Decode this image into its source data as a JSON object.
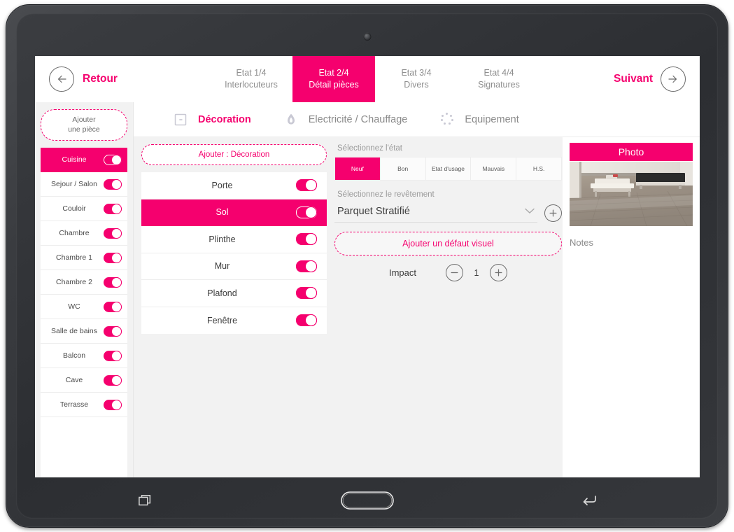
{
  "header": {
    "back_label": "Retour",
    "back_icon": "arrow-left-circle-icon",
    "next_label": "Suivant",
    "next_icon": "arrow-right-circle-icon",
    "steps": [
      {
        "line1": "Etat 1/4",
        "line2": "Interlocuteurs",
        "active": false
      },
      {
        "line1": "Etat 2/4",
        "line2": "Détail pièces",
        "active": true
      },
      {
        "line1": "Etat 3/4",
        "line2": "Divers",
        "active": false
      },
      {
        "line1": "Etat 4/4",
        "line2": "Signatures",
        "active": false
      }
    ]
  },
  "sidebar": {
    "add_room_line1": "Ajouter",
    "add_room_line2": "une pièce",
    "rooms": [
      {
        "label": "Cuisine",
        "selected": true,
        "toggle": true
      },
      {
        "label": "Sejour / Salon",
        "selected": false,
        "toggle": true
      },
      {
        "label": "Couloir",
        "selected": false,
        "toggle": true
      },
      {
        "label": "Chambre",
        "selected": false,
        "toggle": true
      },
      {
        "label": "Chambre 1",
        "selected": false,
        "toggle": true
      },
      {
        "label": "Chambre 2",
        "selected": false,
        "toggle": true
      },
      {
        "label": "WC",
        "selected": false,
        "toggle": true
      },
      {
        "label": "Salle de bains",
        "selected": false,
        "toggle": true
      },
      {
        "label": "Balcon",
        "selected": false,
        "toggle": true
      },
      {
        "label": "Cave",
        "selected": false,
        "toggle": true
      },
      {
        "label": "Terrasse",
        "selected": false,
        "toggle": true
      }
    ]
  },
  "category_tabs": [
    {
      "label": "Décoration",
      "icon": "paint-square-icon",
      "active": true
    },
    {
      "label": "Electricité / Chauffage",
      "icon": "flame-icon",
      "active": false
    },
    {
      "label": "Equipement",
      "icon": "dots-circle-icon",
      "active": false
    }
  ],
  "elements_panel": {
    "add_label": "Ajouter : Décoration",
    "items": [
      {
        "label": "Porte",
        "selected": false,
        "toggle": true
      },
      {
        "label": "Sol",
        "selected": true,
        "toggle": true
      },
      {
        "label": "Plinthe",
        "selected": false,
        "toggle": true
      },
      {
        "label": "Mur",
        "selected": false,
        "toggle": true
      },
      {
        "label": "Plafond",
        "selected": false,
        "toggle": true
      },
      {
        "label": "Fenêtre",
        "selected": false,
        "toggle": true
      }
    ]
  },
  "detail_panel": {
    "state_label": "Sélectionnez l'état",
    "state_options": [
      {
        "label": "Neuf",
        "active": true
      },
      {
        "label": "Bon",
        "active": false
      },
      {
        "label": "Etat d'usage",
        "active": false
      },
      {
        "label": "Mauvais",
        "active": false
      },
      {
        "label": "H.S.",
        "active": false
      }
    ],
    "covering_label": "Sélectionnez le revêtement",
    "covering_value": "Parquet Stratifié",
    "covering_dropdown_icon": "chevron-down-icon",
    "covering_add_icon": "plus-circle-icon",
    "add_defect_label": "Ajouter un défaut visuel",
    "impact_label": "Impact",
    "impact_value": "1",
    "impact_minus_icon": "minus-circle-icon",
    "impact_plus_icon": "plus-circle-icon"
  },
  "photo_panel": {
    "header_label": "Photo",
    "photo_alt": "room-floor-photo",
    "notes_label": "Notes"
  },
  "android_nav": [
    {
      "name": "recents-button",
      "icon": "recents-icon"
    },
    {
      "name": "home-button",
      "icon": "home-icon"
    },
    {
      "name": "back-button",
      "icon": "back-arrow-icon"
    }
  ],
  "colors": {
    "accent": "#f5006e",
    "muted_text": "#8e8e8e",
    "panel_bg": "#f2f2f2"
  }
}
